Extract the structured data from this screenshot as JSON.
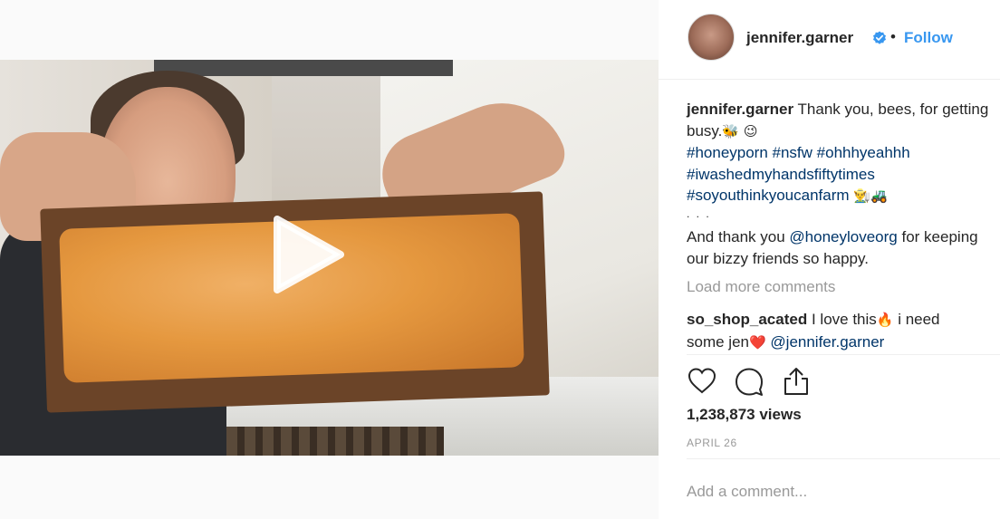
{
  "header": {
    "username": "jennifer.garner",
    "separator": "•",
    "follow_label": "Follow",
    "verified_icon": "verified-badge-icon"
  },
  "caption": {
    "username": "jennifer.garner",
    "text_line1": "Thank you, bees, for getting",
    "text_line2": "busy.",
    "emoji_line2": "🐝 😉",
    "hashtags_line3": "#honeyporn #nsfw #ohhhyeahhh",
    "hashtags_line4": "#iwashedmyhandsfiftytimes",
    "hashtags_line5": "#soyouthinkyoucanfarm",
    "emoji_line5": "👨‍🌾🚜",
    "dots": ". . .",
    "thanks_prefix": "And thank you ",
    "thanks_mention": "@honeyloveorg",
    "thanks_suffix": " for keeping",
    "thanks_line2": "our bizzy friends so happy."
  },
  "load_more_label": "Load more comments",
  "comment": {
    "username": "so_shop_acated",
    "text_part1": "I love this",
    "emoji1": "🔥",
    "text_part2": " i need",
    "text_line2": "some jen",
    "emoji2": "❤️",
    "mention": "@jennifer.garner"
  },
  "actions": {
    "like_icon": "heart-icon",
    "comment_icon": "comment-bubble-icon",
    "share_icon": "share-icon"
  },
  "views": "1,238,873 views",
  "date": "APRIL 26",
  "add_comment_placeholder": "Add a comment...",
  "colors": {
    "link_blue": "#3897f0",
    "hashtag": "#003569",
    "muted": "#999999",
    "text": "#262626"
  }
}
